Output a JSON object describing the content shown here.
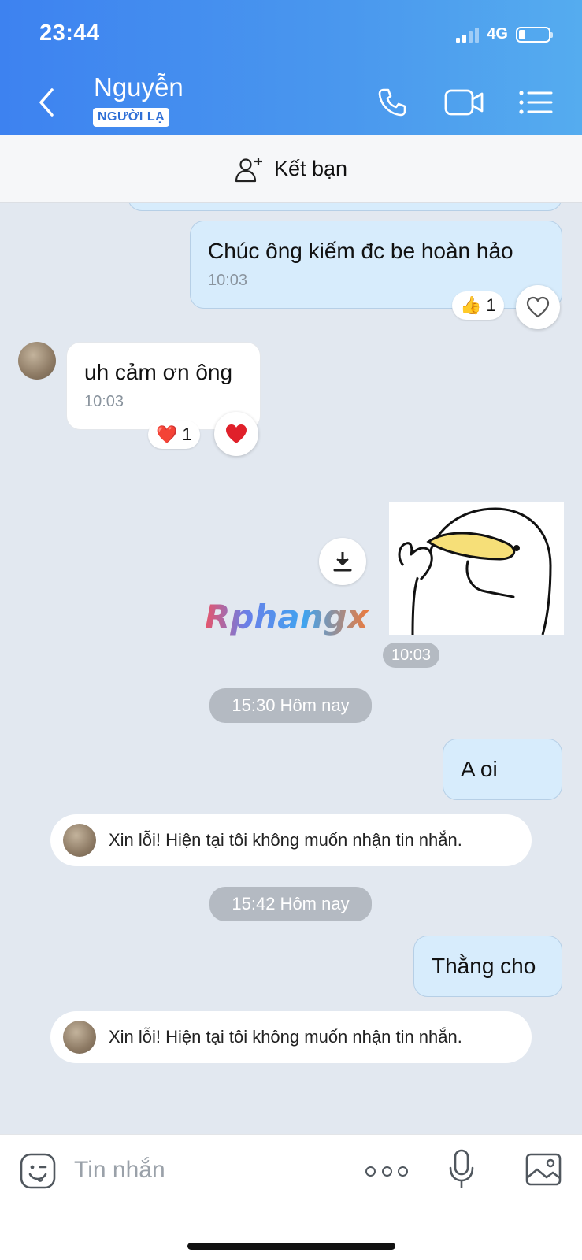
{
  "status_bar": {
    "time": "23:44",
    "network": "4G"
  },
  "header": {
    "contact_name": "Nguyễn",
    "badge": "NGƯỜI LẠ",
    "bg_color": "#4a90ee"
  },
  "add_friend": {
    "label": "Kết bạn"
  },
  "messages": [
    {
      "direction": "out",
      "text": "Chúc ông kiếm đc be hoàn hảo",
      "time": "10:03",
      "reaction": {
        "emoji": "👍",
        "count": "1"
      },
      "react_button": "heart-outline"
    },
    {
      "direction": "in",
      "text": "uh cảm ơn ông",
      "time": "10:03",
      "reaction": {
        "emoji": "❤️",
        "count": "1"
      },
      "react_button": "heart-filled"
    },
    {
      "direction": "out",
      "type": "sticker",
      "watermark": "Rphangx",
      "time": "10:03"
    },
    {
      "type": "date_separator",
      "text": "15:30 Hôm nay"
    },
    {
      "direction": "out",
      "text": "A oi"
    },
    {
      "type": "auto_reply",
      "text": "Xin lỗi! Hiện tại tôi không muốn nhận tin nhắn."
    },
    {
      "type": "date_separator",
      "text": "15:42 Hôm nay"
    },
    {
      "direction": "out",
      "text": "Thằng cho"
    },
    {
      "type": "auto_reply",
      "text": "Xin lỗi! Hiện tại tôi không muốn nhận tin nhắn."
    }
  ],
  "composer": {
    "placeholder": "Tin nhắn"
  },
  "colors": {
    "accent": "#3d82f0",
    "outgoing_bubble": "#d7ecfc",
    "incoming_bubble": "#ffffff",
    "chat_bg": "#e2e8f0"
  }
}
